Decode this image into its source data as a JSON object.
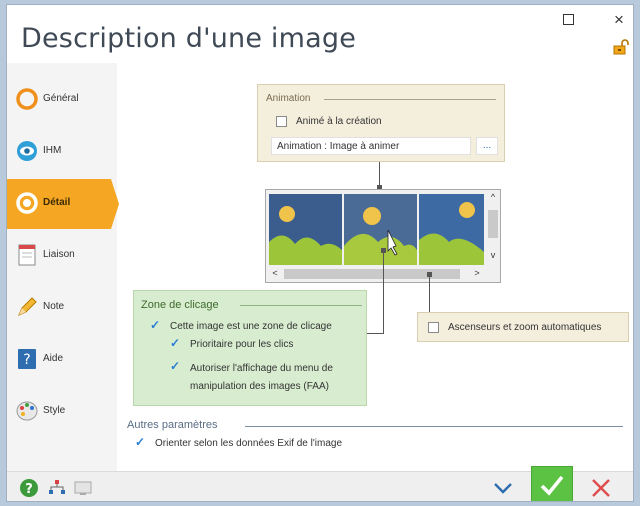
{
  "window": {
    "title": "Description d'une image",
    "controls": {
      "maximize": "□",
      "close": "×"
    }
  },
  "sidebar": {
    "items": [
      {
        "label": "Général",
        "icon": "ring-icon"
      },
      {
        "label": "IHM",
        "icon": "eye-icon"
      },
      {
        "label": "Détail",
        "icon": "ring-icon",
        "active": true
      },
      {
        "label": "Liaison",
        "icon": "document-icon"
      },
      {
        "label": "Note",
        "icon": "pencil-icon"
      },
      {
        "label": "Aide",
        "icon": "help-book-icon"
      },
      {
        "label": "Style",
        "icon": "palette-icon"
      }
    ]
  },
  "animation": {
    "group_title": "Animation",
    "animate_on_create_label": "Animé à la création",
    "animate_on_create_checked": false,
    "image_field_value": "Animation : Image à animer",
    "ellipsis_label": "..."
  },
  "gallery": {
    "hscroll_left": "<",
    "hscroll_right": ">",
    "vscroll_up": "^",
    "vscroll_down": "v"
  },
  "click_zone": {
    "group_title": "Zone de clicage",
    "is_click_zone_label": "Cette image est une zone de clicage",
    "is_click_zone_checked": true,
    "priority_label": "Prioritaire pour les clics",
    "priority_checked": true,
    "allow_menu_label_1": "Autoriser l'affichage du menu de",
    "allow_menu_label_2": "manipulation des images (FAA)",
    "allow_menu_checked": true
  },
  "scroll_zoom": {
    "label": "Ascenseurs et zoom automatiques",
    "checked": false
  },
  "other_params": {
    "group_title": "Autres paramètres",
    "exif_label": "Orienter selon les données Exif de l'image",
    "exif_checked": true
  },
  "colors": {
    "accent_orange": "#f5a623",
    "ok_green": "#5cc244",
    "cancel_red": "#e04b4b",
    "check_blue": "#2a7fd4"
  }
}
